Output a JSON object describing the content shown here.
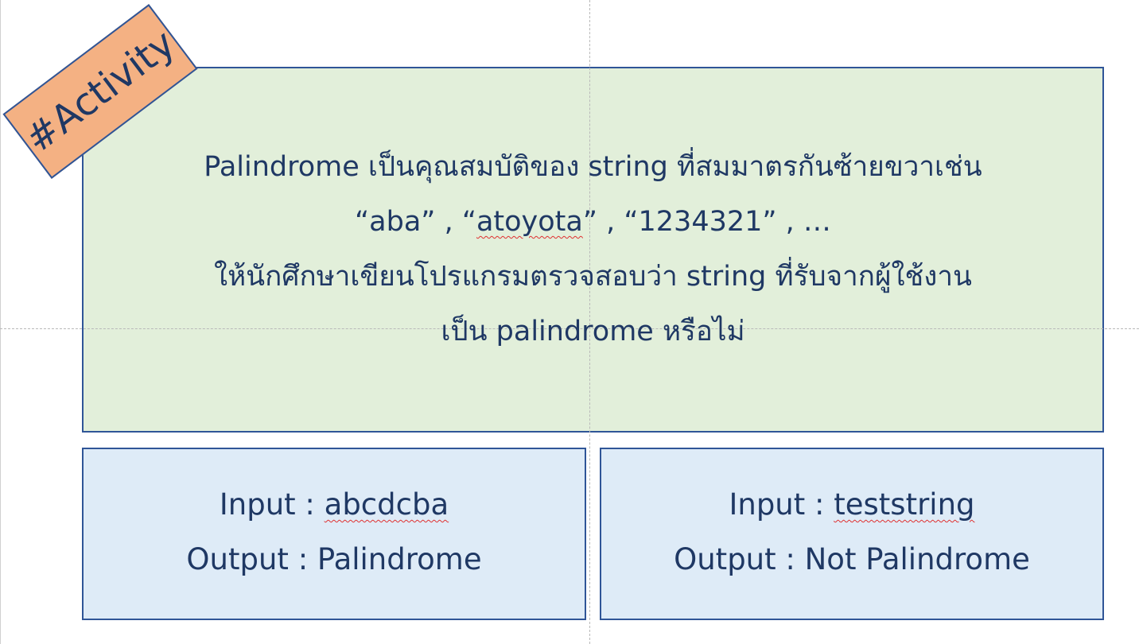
{
  "badge": {
    "label": "#Activity"
  },
  "description": {
    "line1": "Palindrome เป็นคุณสมบัติของ string ที่สมมาตรกันซ้ายขวาเช่น",
    "line2_ex1": "“aba”",
    "line2_sep1": " , ",
    "line2_ex2_open": "“",
    "line2_ex2_word": "atoyota",
    "line2_ex2_close": "”",
    "line2_sep2": " , ",
    "line2_ex3": "“1234321”",
    "line2_tail": " , …",
    "line3": "ให้นักศึกษาเขียนโปรแกรมตรวจสอบว่า string ที่รับจากผู้ใช้งาน",
    "line4": "เป็น palindrome หรือไม่"
  },
  "example1": {
    "input_label": "Input : ",
    "input_value": "abcdcba",
    "output_label": "Output : ",
    "output_value": "Palindrome"
  },
  "example2": {
    "input_label": "Input : ",
    "input_value": "teststring",
    "output_label": "Output : ",
    "output_value": "Not Palindrome"
  },
  "colors": {
    "text": "#1f3864",
    "border": "#2f5597",
    "main_fill": "#e2efda",
    "example_fill": "#deebf7",
    "badge_fill": "#f4b183",
    "spellcheck": "#e03030"
  }
}
